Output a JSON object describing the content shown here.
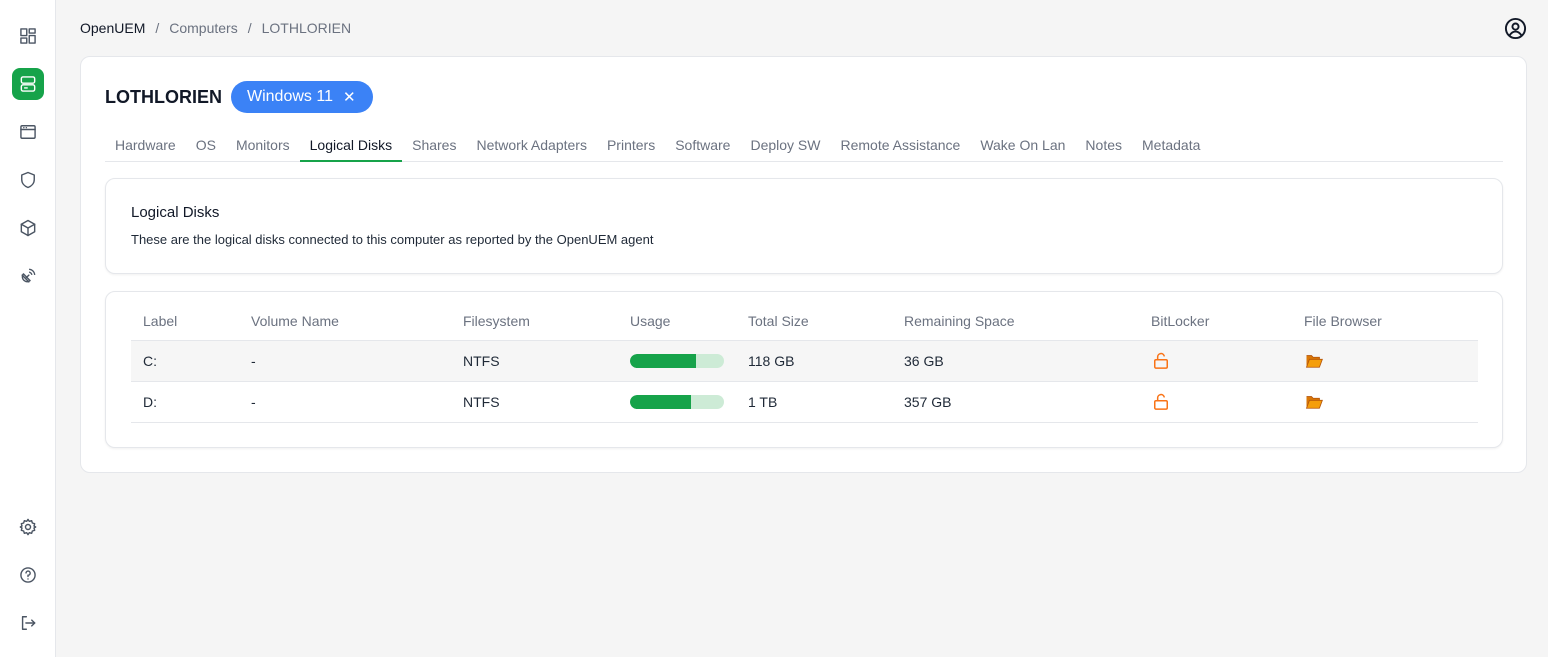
{
  "sidebar": {
    "items": [
      {
        "icon": "dashboard-icon",
        "active": false
      },
      {
        "icon": "computers-icon",
        "active": true
      },
      {
        "icon": "browser-window-icon",
        "active": false
      },
      {
        "icon": "shield-icon",
        "active": false
      },
      {
        "icon": "package-icon",
        "active": false
      },
      {
        "icon": "satellite-icon",
        "active": false
      }
    ],
    "bottom_items": [
      {
        "icon": "gear-icon"
      },
      {
        "icon": "help-icon"
      },
      {
        "icon": "logout-icon"
      }
    ],
    "accent_color": "#16a34a"
  },
  "breadcrumb": [
    "OpenUEM",
    "Computers",
    "LOTHLORIEN"
  ],
  "computer": {
    "name": "LOTHLORIEN",
    "os_badge": "Windows 11",
    "os_badge_close": "✕",
    "badge_color": "#3b82f6"
  },
  "tabs": [
    {
      "label": "Hardware",
      "active": false
    },
    {
      "label": "OS",
      "active": false
    },
    {
      "label": "Monitors",
      "active": false
    },
    {
      "label": "Logical Disks",
      "active": true
    },
    {
      "label": "Shares",
      "active": false
    },
    {
      "label": "Network Adapters",
      "active": false
    },
    {
      "label": "Printers",
      "active": false
    },
    {
      "label": "Software",
      "active": false
    },
    {
      "label": "Deploy SW",
      "active": false
    },
    {
      "label": "Remote Assistance",
      "active": false
    },
    {
      "label": "Wake On Lan",
      "active": false
    },
    {
      "label": "Notes",
      "active": false
    },
    {
      "label": "Metadata",
      "active": false
    }
  ],
  "section": {
    "title": "Logical Disks",
    "description": "These are the logical disks connected to this computer as reported by the OpenUEM agent"
  },
  "table": {
    "columns": [
      "Label",
      "Volume Name",
      "Filesystem",
      "Usage",
      "Total Size",
      "Remaining Space",
      "BitLocker",
      "File Browser"
    ],
    "rows": [
      {
        "label": "C:",
        "volume": "-",
        "filesystem": "NTFS",
        "usage_percent": 70,
        "total": "118 GB",
        "remaining": "36 GB",
        "bitlocker_icon": "unlocked-padlock-icon",
        "file_icon": "open-folder-icon"
      },
      {
        "label": "D:",
        "volume": "-",
        "filesystem": "NTFS",
        "usage_percent": 65,
        "total": "1 TB",
        "remaining": "357 GB",
        "bitlocker_icon": "unlocked-padlock-icon",
        "file_icon": "open-folder-icon"
      }
    ]
  }
}
